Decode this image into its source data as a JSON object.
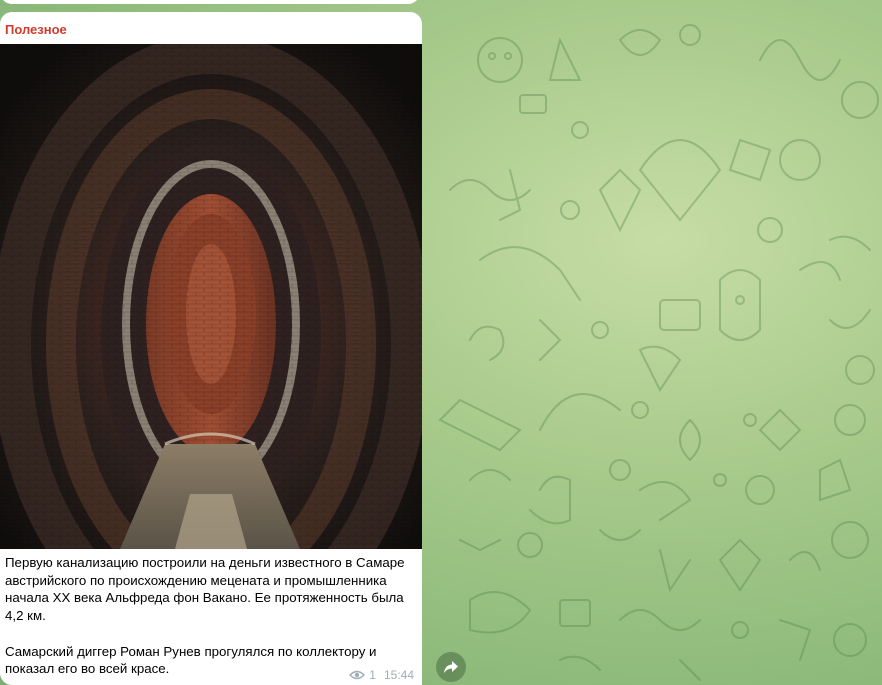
{
  "message": {
    "channel_name": "Полезное",
    "text": {
      "p1_line1": "Первую канализацию построили на деньги известного в Самаре",
      "p1_line2": "австрийского по происхождению мецената и промышленника",
      "p1_line3": "начала XX века Альфреда фон Вакано. Ее протяженность была",
      "p1_line4": "4,2 км.",
      "p2_line1": "Самарский диггер Роман Рунев прогулялся по коллектору и",
      "p2_line2": "показал его во всей красе."
    },
    "views": "1",
    "time": "15:44"
  },
  "icons": {
    "views": "eye-icon",
    "share": "share-arrow-icon"
  },
  "colors": {
    "channel_name": "#d13b2b",
    "meta": "#a0acb6",
    "bubble": "#ffffff",
    "background": "#a9cb8c"
  }
}
